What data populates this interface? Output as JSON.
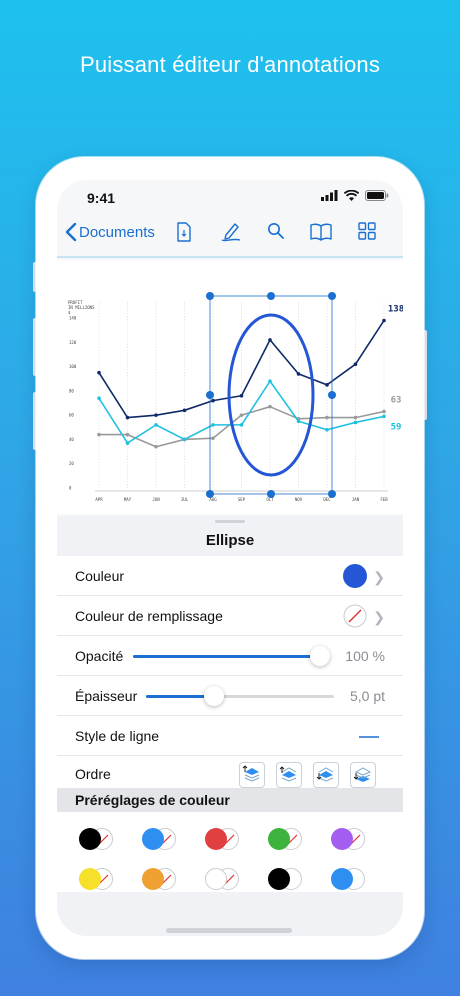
{
  "headline": "Puissant éditeur d'annotations",
  "status_bar": {
    "time": "9:41",
    "icons": [
      "signal-icon",
      "wifi-icon",
      "battery-icon"
    ]
  },
  "toolbar": {
    "back_label": "Documents",
    "icons": [
      "document-icon",
      "pen-icon",
      "search-icon",
      "book-icon",
      "grid-icon"
    ]
  },
  "colors": {
    "accent": "#1a6fd0",
    "ellipse": "#2456d6",
    "series_dark": "#0f2a66",
    "series_cyan": "#1fc1e0",
    "series_gray": "#9a9a9a"
  },
  "chart_data": {
    "type": "line",
    "ylabel": "PROFIT IN MILLIONS $",
    "categories": [
      "APR",
      "MAY",
      "JUN",
      "JUL",
      "AUG",
      "SEP",
      "OCT",
      "NOV",
      "DEC",
      "JAN",
      "FEB"
    ],
    "yticks": [
      "0",
      "20",
      "40",
      "60",
      "80",
      "100",
      "120",
      "140"
    ],
    "ylim": [
      0,
      145
    ],
    "series": [
      {
        "values": [
          95,
          58,
          60,
          64,
          72,
          76,
          122,
          94,
          85,
          102,
          138
        ],
        "color": "#0f2a66",
        "end_label": "138"
      },
      {
        "values": [
          44,
          44,
          34,
          40,
          41,
          60,
          67,
          57,
          58,
          58,
          63
        ],
        "color": "#9a9a9a",
        "end_label": "63"
      },
      {
        "values": [
          74,
          37,
          52,
          40,
          52,
          52,
          88,
          55,
          48,
          54,
          59
        ],
        "color": "#1fc1e0",
        "end_label": "59"
      }
    ],
    "grid": true
  },
  "sheet": {
    "grabber": true,
    "title": "Ellipse",
    "rows": {
      "color": {
        "label": "Couleur",
        "value": "#2456d6"
      },
      "fill_color": {
        "label": "Couleur de remplissage",
        "value": "none"
      },
      "opacity": {
        "label": "Opacité",
        "value": "100 %",
        "fraction": 1.0
      },
      "thickness": {
        "label": "Épaisseur",
        "value": "5,0 pt",
        "fraction": 0.36
      },
      "line_style": {
        "label": "Style de ligne",
        "value": "solid"
      },
      "order": {
        "label": "Ordre",
        "buttons": [
          "bring-to-front-icon",
          "bring-forward-icon",
          "send-backward-icon",
          "send-to-back-icon"
        ]
      }
    },
    "presets": {
      "header": "Préréglages de couleur",
      "items": [
        {
          "stroke": "#000000",
          "fill": "none"
        },
        {
          "stroke": "#2f8ff0",
          "fill": "none"
        },
        {
          "stroke": "#e04040",
          "fill": "none"
        },
        {
          "stroke": "#3db33d",
          "fill": "none"
        },
        {
          "stroke": "#a35df0",
          "fill": "none"
        },
        {
          "stroke": "#f6e02a",
          "fill": "none"
        },
        {
          "stroke": "#f0a030",
          "fill": "none"
        },
        {
          "stroke": "#ffffff",
          "fill": "none"
        },
        {
          "stroke": "#000000",
          "fill": "#ffffff"
        },
        {
          "stroke": "#2f8ff0",
          "fill": "#ffffff"
        }
      ]
    }
  }
}
